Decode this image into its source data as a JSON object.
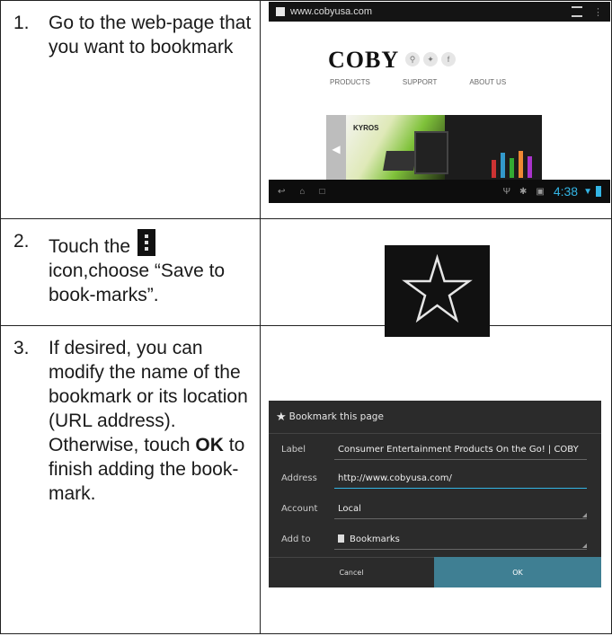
{
  "steps": [
    {
      "num": "1.",
      "text": "Go to the web-page that you want to bookmark"
    },
    {
      "num": "2.",
      "text_before": "Touch the",
      "text_after": "icon,choose “Save to book-marks”."
    },
    {
      "num": "3.",
      "text_before": "If desired, you can modify the name of the bookmark or its location (URL address). Otherwise, touch",
      "bold": "OK",
      "text_after": "to finish adding the book-mark."
    }
  ],
  "browser": {
    "url": "www.cobyusa.com",
    "logo": "COBY",
    "nav": [
      "PRODUCTS",
      "SUPPORT",
      "ABOUT US"
    ],
    "banner_title": "KYROS",
    "clock": "4:38"
  },
  "dialog": {
    "title": "Bookmark this page",
    "fields": [
      {
        "label": "Label",
        "value": "Consumer Entertainment Products On the Go! | COBY"
      },
      {
        "label": "Address",
        "value": "http://www.cobyusa.com/"
      },
      {
        "label": "Account",
        "value": "Local"
      },
      {
        "label": "Add to",
        "value": "Bookmarks"
      }
    ],
    "cancel": "Cancel",
    "ok": "OK"
  },
  "colors": {
    "accent": "#33b5e5",
    "ok_button": "#3f7f93"
  }
}
